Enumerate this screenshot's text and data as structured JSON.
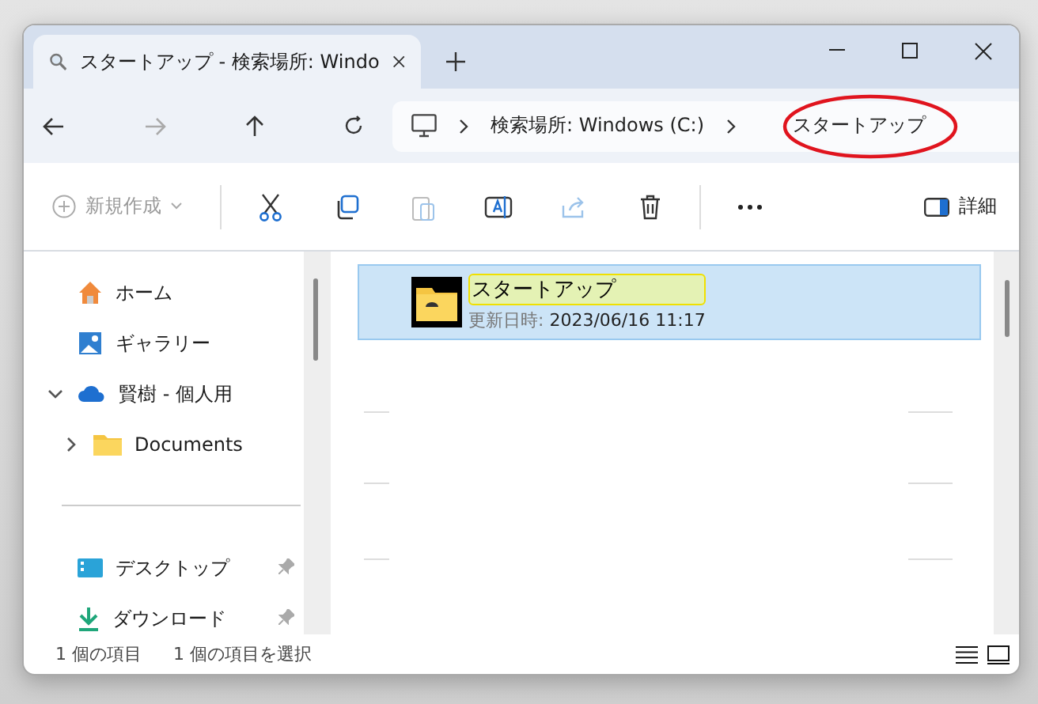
{
  "tab": {
    "title": "スタートアップ - 検索場所: Windo",
    "selected": true
  },
  "breadcrumb": [
    "検索場所: Windows (C:)",
    "スタートアップ"
  ],
  "toolbar": {
    "new_label": "新規作成",
    "details_label": "詳細"
  },
  "sidebar": {
    "items": [
      {
        "kind": "home",
        "label": "ホーム"
      },
      {
        "kind": "gallery",
        "label": "ギャラリー"
      },
      {
        "kind": "cloud",
        "label": "賢樹 - 個人用",
        "expanded": true,
        "children": [
          {
            "kind": "folder",
            "label": "Documents",
            "expanded": false
          }
        ]
      },
      {
        "kind": "divider"
      },
      {
        "kind": "desktop",
        "label": "デスクトップ",
        "pinned": true
      },
      {
        "kind": "download",
        "label": "ダウンロード",
        "pinned": true
      }
    ]
  },
  "files": [
    {
      "name": "スタートアップ",
      "meta_label": "更新日時:",
      "meta_value": "2023/06/16 11:17",
      "selected": true
    }
  ],
  "status_bar": {
    "count": "1 個の項目",
    "selection": "1 個の項目を選択"
  }
}
